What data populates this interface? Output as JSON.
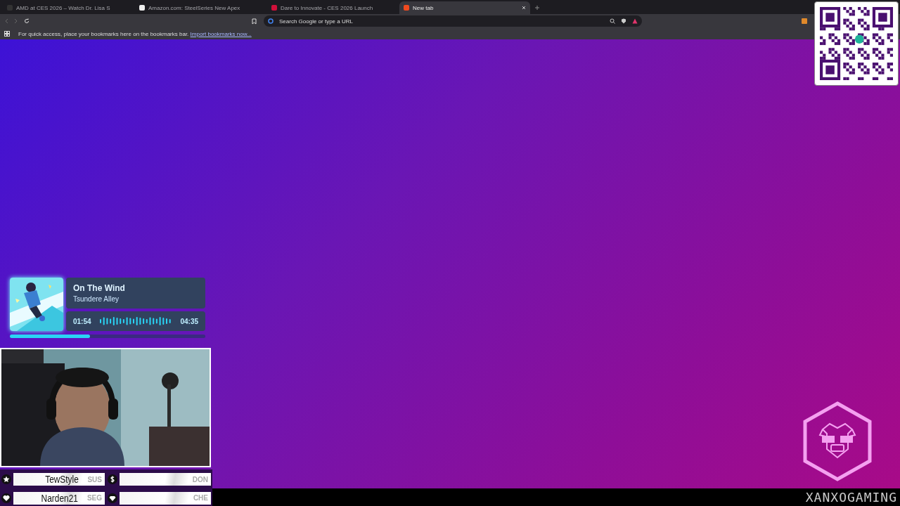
{
  "browser": {
    "tabs": [
      {
        "title": "AMD at CES 2026 – Watch Dr. Lisa S",
        "kind": "page",
        "selected": false
      },
      {
        "title": "Amazon.com: SteelSeries New Apex",
        "kind": "amazon",
        "selected": false
      },
      {
        "title": "Dare to Innovate - CES 2026 Launch",
        "kind": "video",
        "selected": false
      },
      {
        "title": "New tab",
        "kind": "lion",
        "selected": true
      }
    ],
    "address_bar": {
      "placeholder": "Search Google or type a URL"
    },
    "bookmarks_bar": {
      "message": "For quick access, place your bookmarks here on the bookmarks bar.",
      "link": "Import bookmarks now..."
    }
  },
  "now_playing": {
    "title": "On The Wind",
    "artist": "Tsundere Alley",
    "elapsed": "01:54",
    "duration": "04:35",
    "level": 0.41
  },
  "supporters": [
    {
      "kind": "star",
      "name": "TewStyle",
      "tag": "SUS"
    },
    {
      "kind": "dollar",
      "tag": "DON"
    },
    {
      "kind": "heart",
      "name": "Narden21",
      "tag": "SEG"
    },
    {
      "kind": "gem",
      "tag": "CHE"
    }
  ],
  "brand": {
    "name": "XANXOGAMING"
  }
}
